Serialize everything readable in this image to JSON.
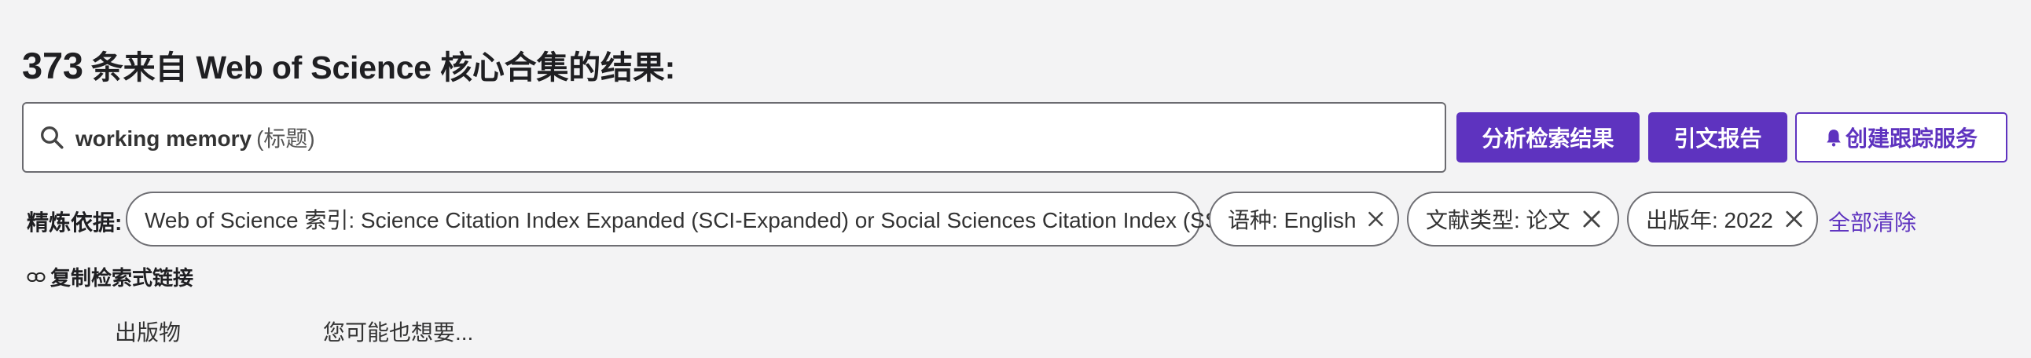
{
  "results_header": {
    "count": "373",
    "text": "条来自 Web of Science 核心合集的结果:"
  },
  "search": {
    "term": "working memory",
    "field": "(标题)"
  },
  "buttons": {
    "analyze": "分析检索结果",
    "citation_report": "引文报告",
    "create_alert": "创建跟踪服务"
  },
  "refine": {
    "label": "精炼依据:",
    "chips": [
      {
        "text": "Web of Science 索引: Science Citation Index Expanded (SCI-Expanded) or Social Sciences Citation Index (SSCI)"
      },
      {
        "text": "语种: English"
      },
      {
        "text": "文献类型: 论文"
      },
      {
        "text": "出版年: 2022"
      }
    ],
    "clear_all": "全部清除"
  },
  "copy_link": "复制检索式链接",
  "columns": {
    "publications": "出版物",
    "suggestions": "您可能也想要..."
  },
  "colors": {
    "accent": "#5e33bf",
    "background": "#f3f3f4"
  },
  "icons": [
    "search-icon",
    "close-icon",
    "bell-icon",
    "link-icon"
  ]
}
